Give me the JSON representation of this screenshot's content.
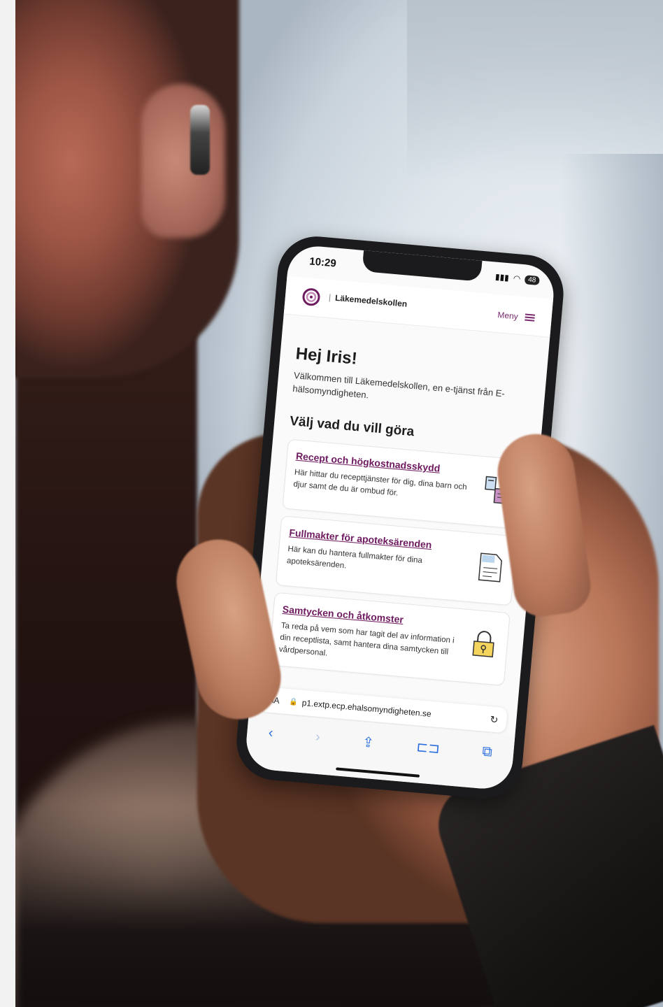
{
  "status": {
    "time": "10:29",
    "battery": "48"
  },
  "header": {
    "title": "Läkemedelskollen",
    "menu_label": "Meny"
  },
  "main": {
    "greeting": "Hej Iris!",
    "intro": "Välkommen till Läkemedelskollen, en e-tjänst från E-hälsomyndigheten.",
    "section_title": "Välj vad du vill göra",
    "cards": [
      {
        "title": "Recept och högkostnadsskydd",
        "text": "Här hittar du recepttjänster för dig, dina barn och djur samt de du är ombud för.",
        "icon": "prescription-icon"
      },
      {
        "title": "Fullmakter för apoteksärenden",
        "text": "Här kan du hantera fullmakter för dina apoteksärenden.",
        "icon": "document-icon"
      },
      {
        "title": "Samtycken och åtkomster",
        "text": "Ta reda på vem som har tagit del av information i din receptlista, samt hantera dina samtycken till vårdpersonal.",
        "icon": "padlock-icon"
      }
    ]
  },
  "browser": {
    "aa": "AA",
    "url": "p1.extp.ecp.ehalsomyndigheten.se",
    "icons": [
      "back-icon",
      "forward-icon",
      "share-icon",
      "bookmarks-icon",
      "tabs-icon"
    ]
  },
  "colors": {
    "brand": "#6e1a5f",
    "link_blue": "#2b6fe0"
  }
}
